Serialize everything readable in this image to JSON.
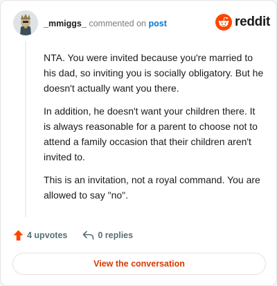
{
  "header": {
    "username": "_mmiggs_",
    "commented_text": "commented on",
    "post_link": "post",
    "brand": "reddit",
    "brand_color": "#ff4500"
  },
  "comment": {
    "paragraphs": [
      "NTA. You were invited because you're married to his dad, so inviting you is socially obligatory. But he doesn't actually want you there.",
      "In addition, he doesn't want your children there. It is always reasonable for a parent to choose not to attend a family occasion that their children aren't invited to.",
      "This is an invitation, not a royal command. You are allowed to say \"no\"."
    ]
  },
  "footer": {
    "upvotes": "4 upvotes",
    "replies": "0 replies",
    "view_button": "View the conversation",
    "upvote_color": "#ff4500",
    "view_color": "#d93a00"
  },
  "icons": {
    "upvote": "arrow-up-icon",
    "reply": "reply-arrow-icon",
    "brand": "reddit-snoo-icon",
    "avatar": "user-avatar"
  }
}
